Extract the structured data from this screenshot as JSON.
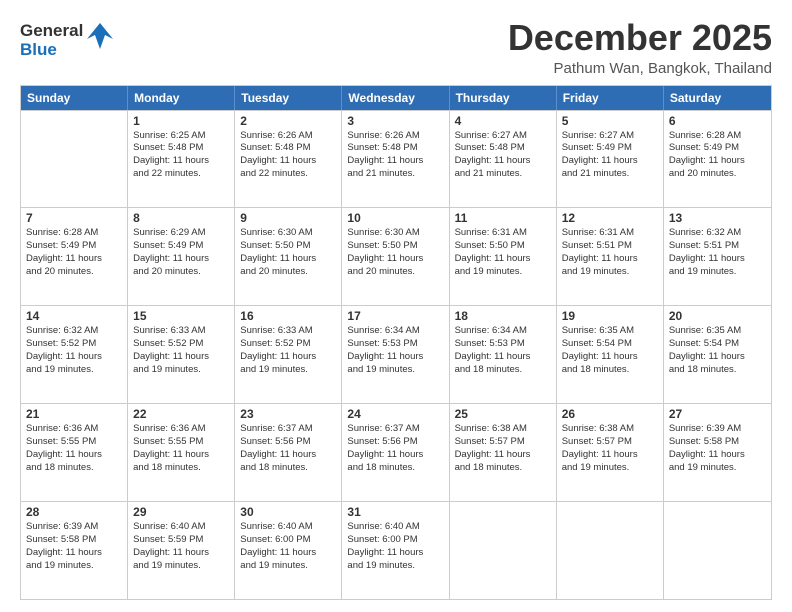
{
  "logo": {
    "general": "General",
    "blue": "Blue"
  },
  "title": "December 2025",
  "location": "Pathum Wan, Bangkok, Thailand",
  "header_days": [
    "Sunday",
    "Monday",
    "Tuesday",
    "Wednesday",
    "Thursday",
    "Friday",
    "Saturday"
  ],
  "weeks": [
    [
      {
        "day": "",
        "lines": []
      },
      {
        "day": "1",
        "lines": [
          "Sunrise: 6:25 AM",
          "Sunset: 5:48 PM",
          "Daylight: 11 hours",
          "and 22 minutes."
        ]
      },
      {
        "day": "2",
        "lines": [
          "Sunrise: 6:26 AM",
          "Sunset: 5:48 PM",
          "Daylight: 11 hours",
          "and 22 minutes."
        ]
      },
      {
        "day": "3",
        "lines": [
          "Sunrise: 6:26 AM",
          "Sunset: 5:48 PM",
          "Daylight: 11 hours",
          "and 21 minutes."
        ]
      },
      {
        "day": "4",
        "lines": [
          "Sunrise: 6:27 AM",
          "Sunset: 5:48 PM",
          "Daylight: 11 hours",
          "and 21 minutes."
        ]
      },
      {
        "day": "5",
        "lines": [
          "Sunrise: 6:27 AM",
          "Sunset: 5:49 PM",
          "Daylight: 11 hours",
          "and 21 minutes."
        ]
      },
      {
        "day": "6",
        "lines": [
          "Sunrise: 6:28 AM",
          "Sunset: 5:49 PM",
          "Daylight: 11 hours",
          "and 20 minutes."
        ]
      }
    ],
    [
      {
        "day": "7",
        "lines": [
          "Sunrise: 6:28 AM",
          "Sunset: 5:49 PM",
          "Daylight: 11 hours",
          "and 20 minutes."
        ]
      },
      {
        "day": "8",
        "lines": [
          "Sunrise: 6:29 AM",
          "Sunset: 5:49 PM",
          "Daylight: 11 hours",
          "and 20 minutes."
        ]
      },
      {
        "day": "9",
        "lines": [
          "Sunrise: 6:30 AM",
          "Sunset: 5:50 PM",
          "Daylight: 11 hours",
          "and 20 minutes."
        ]
      },
      {
        "day": "10",
        "lines": [
          "Sunrise: 6:30 AM",
          "Sunset: 5:50 PM",
          "Daylight: 11 hours",
          "and 20 minutes."
        ]
      },
      {
        "day": "11",
        "lines": [
          "Sunrise: 6:31 AM",
          "Sunset: 5:50 PM",
          "Daylight: 11 hours",
          "and 19 minutes."
        ]
      },
      {
        "day": "12",
        "lines": [
          "Sunrise: 6:31 AM",
          "Sunset: 5:51 PM",
          "Daylight: 11 hours",
          "and 19 minutes."
        ]
      },
      {
        "day": "13",
        "lines": [
          "Sunrise: 6:32 AM",
          "Sunset: 5:51 PM",
          "Daylight: 11 hours",
          "and 19 minutes."
        ]
      }
    ],
    [
      {
        "day": "14",
        "lines": [
          "Sunrise: 6:32 AM",
          "Sunset: 5:52 PM",
          "Daylight: 11 hours",
          "and 19 minutes."
        ]
      },
      {
        "day": "15",
        "lines": [
          "Sunrise: 6:33 AM",
          "Sunset: 5:52 PM",
          "Daylight: 11 hours",
          "and 19 minutes."
        ]
      },
      {
        "day": "16",
        "lines": [
          "Sunrise: 6:33 AM",
          "Sunset: 5:52 PM",
          "Daylight: 11 hours",
          "and 19 minutes."
        ]
      },
      {
        "day": "17",
        "lines": [
          "Sunrise: 6:34 AM",
          "Sunset: 5:53 PM",
          "Daylight: 11 hours",
          "and 19 minutes."
        ]
      },
      {
        "day": "18",
        "lines": [
          "Sunrise: 6:34 AM",
          "Sunset: 5:53 PM",
          "Daylight: 11 hours",
          "and 18 minutes."
        ]
      },
      {
        "day": "19",
        "lines": [
          "Sunrise: 6:35 AM",
          "Sunset: 5:54 PM",
          "Daylight: 11 hours",
          "and 18 minutes."
        ]
      },
      {
        "day": "20",
        "lines": [
          "Sunrise: 6:35 AM",
          "Sunset: 5:54 PM",
          "Daylight: 11 hours",
          "and 18 minutes."
        ]
      }
    ],
    [
      {
        "day": "21",
        "lines": [
          "Sunrise: 6:36 AM",
          "Sunset: 5:55 PM",
          "Daylight: 11 hours",
          "and 18 minutes."
        ]
      },
      {
        "day": "22",
        "lines": [
          "Sunrise: 6:36 AM",
          "Sunset: 5:55 PM",
          "Daylight: 11 hours",
          "and 18 minutes."
        ]
      },
      {
        "day": "23",
        "lines": [
          "Sunrise: 6:37 AM",
          "Sunset: 5:56 PM",
          "Daylight: 11 hours",
          "and 18 minutes."
        ]
      },
      {
        "day": "24",
        "lines": [
          "Sunrise: 6:37 AM",
          "Sunset: 5:56 PM",
          "Daylight: 11 hours",
          "and 18 minutes."
        ]
      },
      {
        "day": "25",
        "lines": [
          "Sunrise: 6:38 AM",
          "Sunset: 5:57 PM",
          "Daylight: 11 hours",
          "and 18 minutes."
        ]
      },
      {
        "day": "26",
        "lines": [
          "Sunrise: 6:38 AM",
          "Sunset: 5:57 PM",
          "Daylight: 11 hours",
          "and 19 minutes."
        ]
      },
      {
        "day": "27",
        "lines": [
          "Sunrise: 6:39 AM",
          "Sunset: 5:58 PM",
          "Daylight: 11 hours",
          "and 19 minutes."
        ]
      }
    ],
    [
      {
        "day": "28",
        "lines": [
          "Sunrise: 6:39 AM",
          "Sunset: 5:58 PM",
          "Daylight: 11 hours",
          "and 19 minutes."
        ]
      },
      {
        "day": "29",
        "lines": [
          "Sunrise: 6:40 AM",
          "Sunset: 5:59 PM",
          "Daylight: 11 hours",
          "and 19 minutes."
        ]
      },
      {
        "day": "30",
        "lines": [
          "Sunrise: 6:40 AM",
          "Sunset: 6:00 PM",
          "Daylight: 11 hours",
          "and 19 minutes."
        ]
      },
      {
        "day": "31",
        "lines": [
          "Sunrise: 6:40 AM",
          "Sunset: 6:00 PM",
          "Daylight: 11 hours",
          "and 19 minutes."
        ]
      },
      {
        "day": "",
        "lines": []
      },
      {
        "day": "",
        "lines": []
      },
      {
        "day": "",
        "lines": []
      }
    ]
  ]
}
